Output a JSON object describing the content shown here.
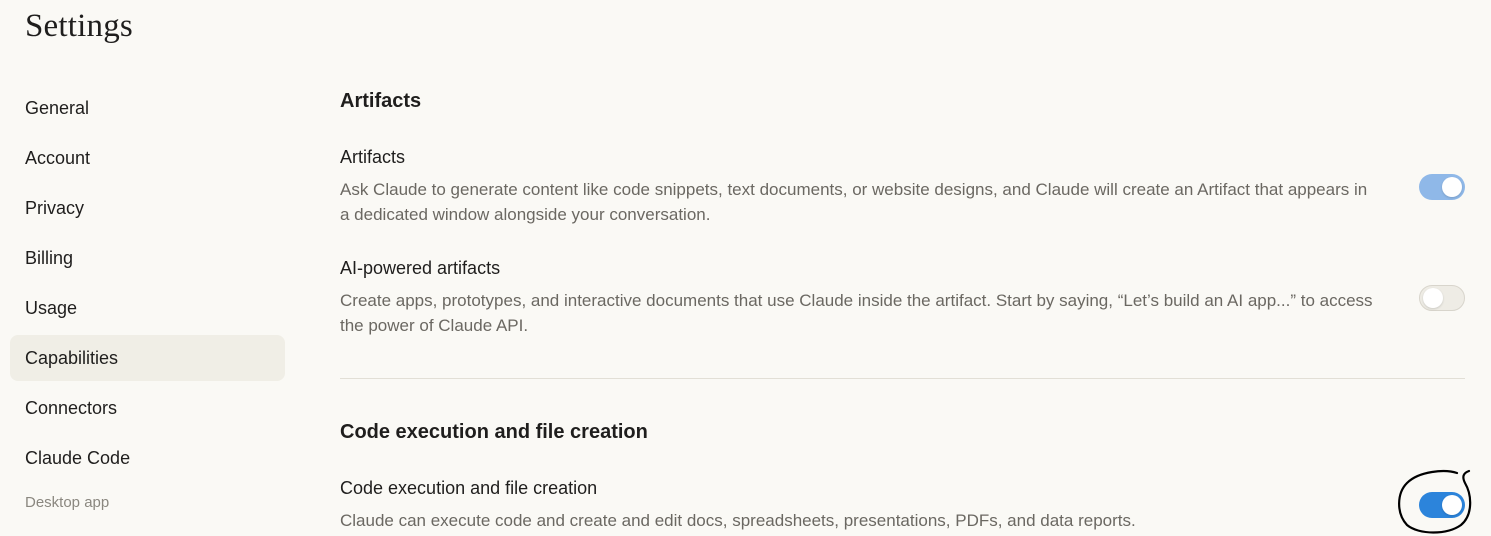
{
  "header": {
    "title": "Settings"
  },
  "sidebar": {
    "items": [
      {
        "label": "General"
      },
      {
        "label": "Account"
      },
      {
        "label": "Privacy"
      },
      {
        "label": "Billing"
      },
      {
        "label": "Usage"
      },
      {
        "label": "Capabilities",
        "active": true
      },
      {
        "label": "Connectors"
      },
      {
        "label": "Claude Code"
      }
    ],
    "section_label": "Desktop app"
  },
  "main": {
    "artifacts_section": {
      "heading": "Artifacts",
      "settings": [
        {
          "title": "Artifacts",
          "description": "Ask Claude to generate content like code snippets, text documents, or website designs, and Claude will create an Artifact that appears in a dedicated window alongside your conversation.",
          "enabled": true
        },
        {
          "title": "AI-powered artifacts",
          "description": "Create apps, prototypes, and interactive documents that use Claude inside the artifact. Start by saying, “Let’s build an AI app...” to access the power of Claude API.",
          "enabled": false
        }
      ]
    },
    "code_section": {
      "heading": "Code execution and file creation",
      "settings": [
        {
          "title": "Code execution and file creation",
          "description": "Claude can execute code and create and edit docs, spreadsheets, presentations, PDFs, and data reports.",
          "enabled": true
        }
      ]
    }
  },
  "colors": {
    "background": "#faf9f5",
    "toggle_on_light": "#8fb8e8",
    "toggle_on": "#2c84db",
    "toggle_off": "#eeece5",
    "active_nav": "#f0eee6",
    "annotation": "#000000"
  }
}
